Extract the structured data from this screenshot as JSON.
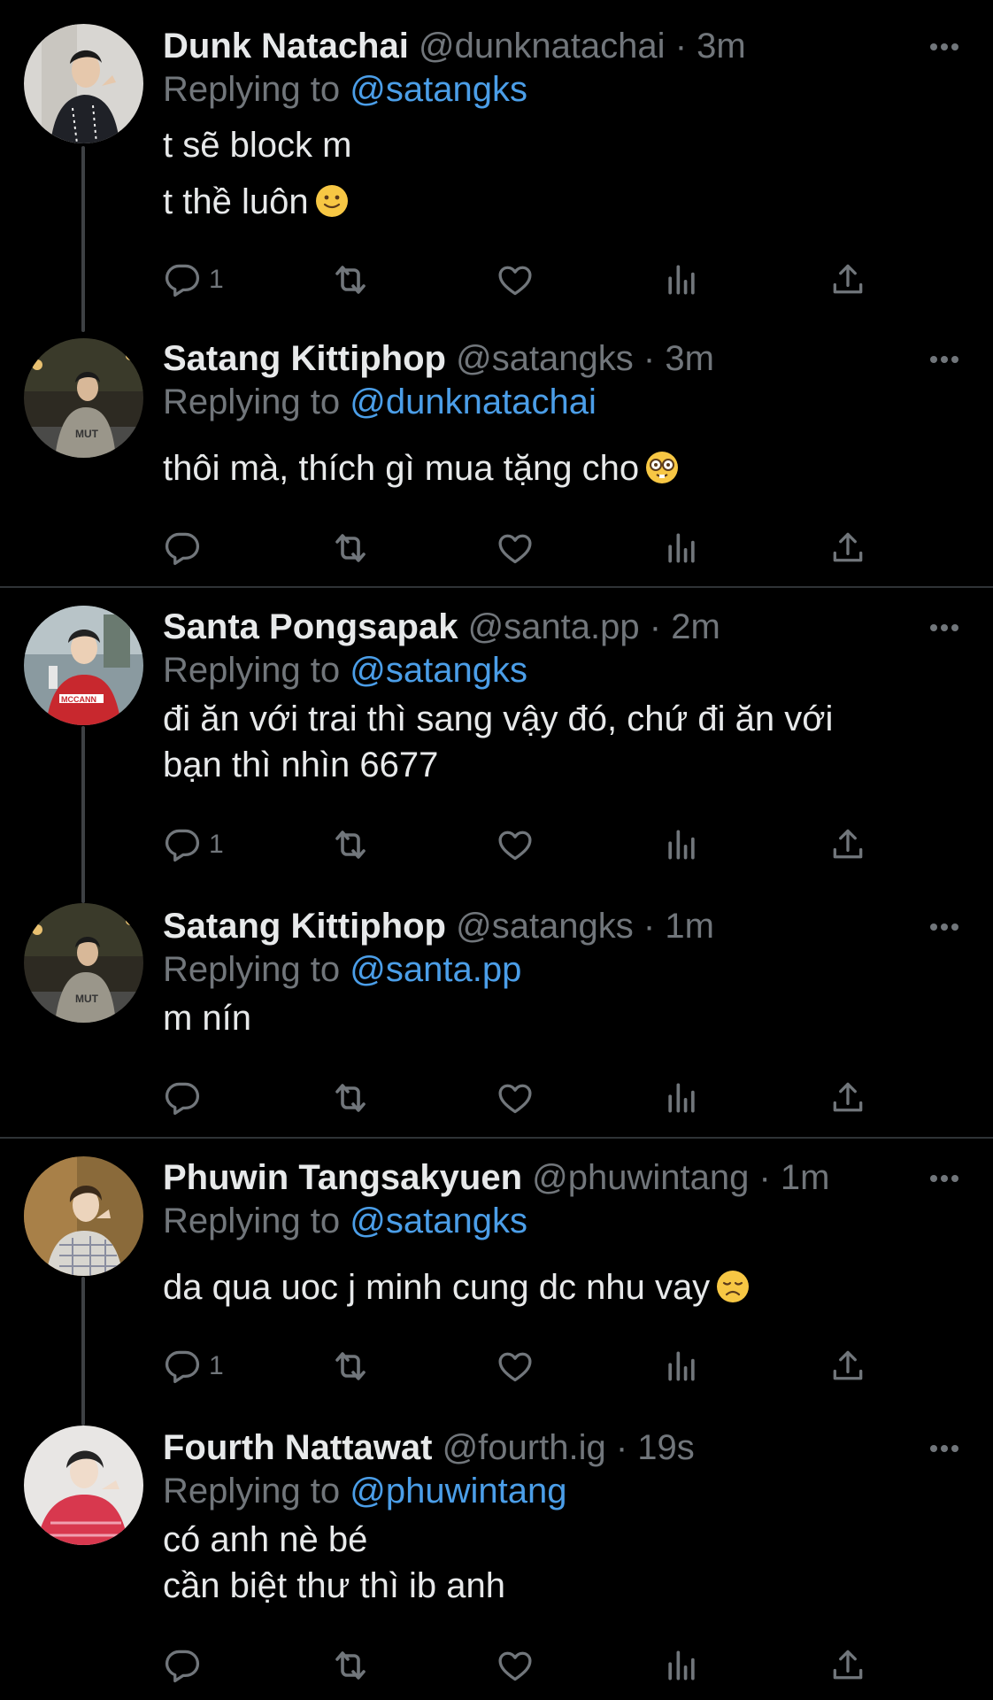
{
  "colors": {
    "background": "#000000",
    "text": "#e7e9ea",
    "muted": "#71767b",
    "mention": "#4b9ee8",
    "divider": "#2f3336"
  },
  "labels": {
    "replying_to": "Replying to",
    "dot": "·"
  },
  "tweets": [
    {
      "name": "Dunk Natachai",
      "handle": "@dunknatachai",
      "time": "3m",
      "replying_to": "@satangks",
      "text_lines": [
        "t sẽ block m",
        "t thề luôn"
      ],
      "emoji": "slightly-smiling-face",
      "reply_count": "1"
    },
    {
      "name": "Satang Kittiphop",
      "handle": "@satangks",
      "time": "3m",
      "replying_to": "@dunknatachai",
      "text": "thôi mà, thích gì mua tặng cho",
      "emoji": "nerd-face",
      "reply_count": ""
    },
    {
      "name": "Santa Pongsapak",
      "handle": "@santa.pp",
      "time": "2m",
      "replying_to": "@satangks",
      "text": "đi ăn với trai thì sang vậy đó, chứ đi ăn với\nbạn thì nhìn 6677",
      "reply_count": "1"
    },
    {
      "name": "Satang Kittiphop",
      "handle": "@satangks",
      "time": "1m",
      "replying_to": "@santa.pp",
      "text": "m nín",
      "reply_count": ""
    },
    {
      "name": "Phuwin Tangsakyuen",
      "handle": "@phuwintang",
      "time": "1m",
      "replying_to": "@satangks",
      "text": "da qua uoc j minh cung dc nhu vay",
      "emoji": "disappointed-face",
      "reply_count": "1"
    },
    {
      "name": "Fourth Nattawat",
      "handle": "@fourth.ig",
      "time": "19s",
      "replying_to": "@phuwintang",
      "text": "có anh nè bé\ncần biệt thư thì ib anh",
      "reply_count": ""
    }
  ]
}
